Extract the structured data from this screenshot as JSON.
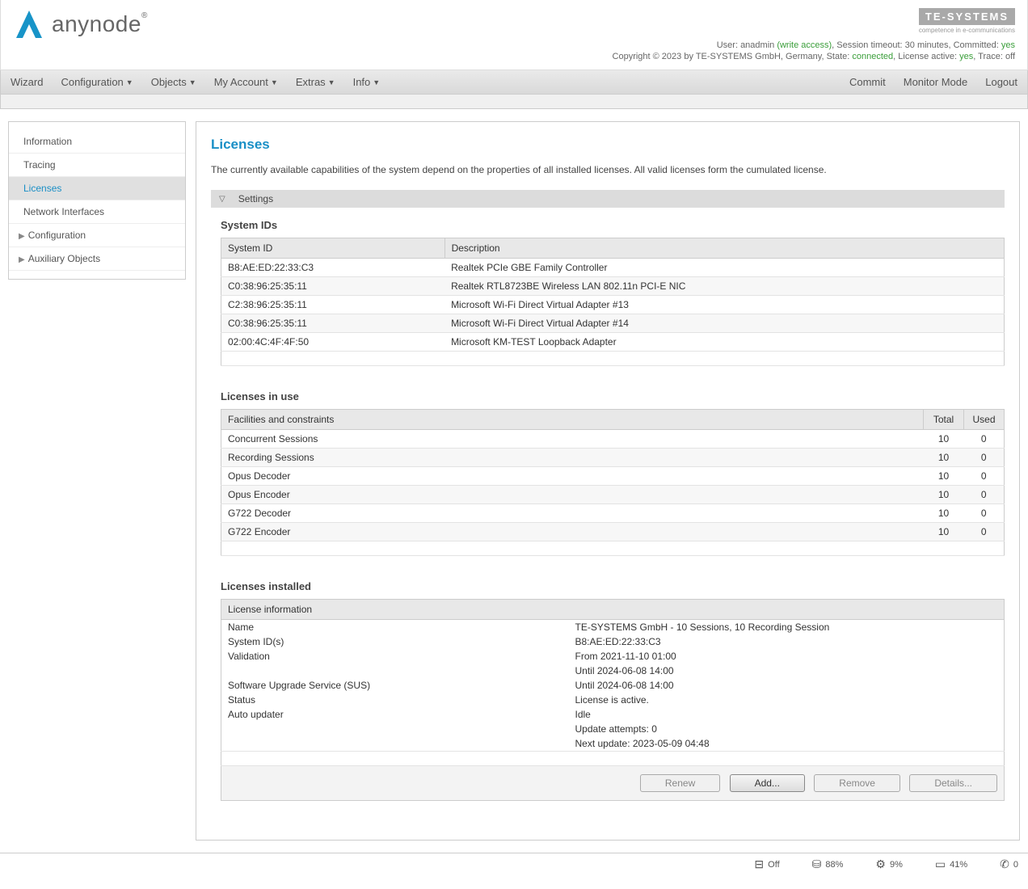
{
  "header": {
    "brand": "anynode",
    "te_brand": "TE-SYSTEMS",
    "te_tagline": "competence in e-communications",
    "status1_pre": "User: ",
    "status1_user": "anadmin",
    "status1_access": "(write access)",
    "status1_mid": ", Session timeout: 30 minutes, Committed: ",
    "status1_committed": "yes",
    "status2_pre": "Copyright © 2023 by TE-SYSTEMS GmbH, Germany, State: ",
    "status2_state": "connected",
    "status2_mid": ", License active: ",
    "status2_license": "yes",
    "status2_trace_label": ", Trace: ",
    "status2_trace": "off"
  },
  "menu": {
    "wizard": "Wizard",
    "configuration": "Configuration",
    "objects": "Objects",
    "my_account": "My Account",
    "extras": "Extras",
    "info": "Info",
    "commit": "Commit",
    "monitor": "Monitor Mode",
    "logout": "Logout"
  },
  "sidebar": {
    "information": "Information",
    "tracing": "Tracing",
    "licenses": "Licenses",
    "network": "Network Interfaces",
    "configuration": "Configuration",
    "auxiliary": "Auxiliary Objects"
  },
  "main": {
    "title": "Licenses",
    "desc": "The currently available capabilities of the system depend on the properties of all installed licenses. All valid licenses form the cumulated license.",
    "settings_label": "Settings",
    "system_ids_title": "System IDs",
    "system_ids_headers": {
      "id": "System ID",
      "desc": "Description"
    },
    "system_ids": [
      {
        "id": "B8:AE:ED:22:33:C3",
        "desc": "Realtek PCIe GBE Family Controller"
      },
      {
        "id": "C0:38:96:25:35:11",
        "desc": "Realtek RTL8723BE Wireless LAN 802.11n PCI-E NIC"
      },
      {
        "id": "C2:38:96:25:35:11",
        "desc": "Microsoft Wi-Fi Direct Virtual Adapter #13"
      },
      {
        "id": "C0:38:96:25:35:11",
        "desc": "Microsoft Wi-Fi Direct Virtual Adapter #14"
      },
      {
        "id": "02:00:4C:4F:4F:50",
        "desc": "Microsoft KM-TEST Loopback Adapter"
      }
    ],
    "inuse_title": "Licenses in use",
    "inuse_headers": {
      "fac": "Facilities and constraints",
      "total": "Total",
      "used": "Used"
    },
    "inuse": [
      {
        "fac": "Concurrent Sessions",
        "total": "10",
        "used": "0"
      },
      {
        "fac": "Recording Sessions",
        "total": "10",
        "used": "0"
      },
      {
        "fac": "Opus Decoder",
        "total": "10",
        "used": "0"
      },
      {
        "fac": "Opus Encoder",
        "total": "10",
        "used": "0"
      },
      {
        "fac": "G722 Decoder",
        "total": "10",
        "used": "0"
      },
      {
        "fac": "G722 Encoder",
        "total": "10",
        "used": "0"
      }
    ],
    "installed_title": "Licenses installed",
    "installed_header": "License information",
    "info": {
      "name_label": "Name",
      "name_val": "TE-SYSTEMS GmbH - 10 Sessions, 10 Recording Session",
      "sysid_label": "System ID(s)",
      "sysid_val": "B8:AE:ED:22:33:C3",
      "validation_label": "Validation",
      "validation_val1": "From 2021-11-10 01:00",
      "validation_val2": "Until 2024-06-08 14:00",
      "sus_label": "Software Upgrade Service (SUS)",
      "sus_val": "Until 2024-06-08 14:00",
      "status_label": "Status",
      "status_val": "License is active.",
      "auto_label": "Auto updater",
      "auto_val1": "Idle",
      "auto_val2": "Update attempts: 0",
      "auto_val3": "Next update: 2023-05-09 04:48"
    },
    "buttons": {
      "renew": "Renew",
      "add": "Add...",
      "remove": "Remove",
      "details": "Details..."
    }
  },
  "footer": {
    "off": "Off",
    "disk": "88%",
    "cpu": "9%",
    "mem": "41%",
    "last": "0"
  }
}
